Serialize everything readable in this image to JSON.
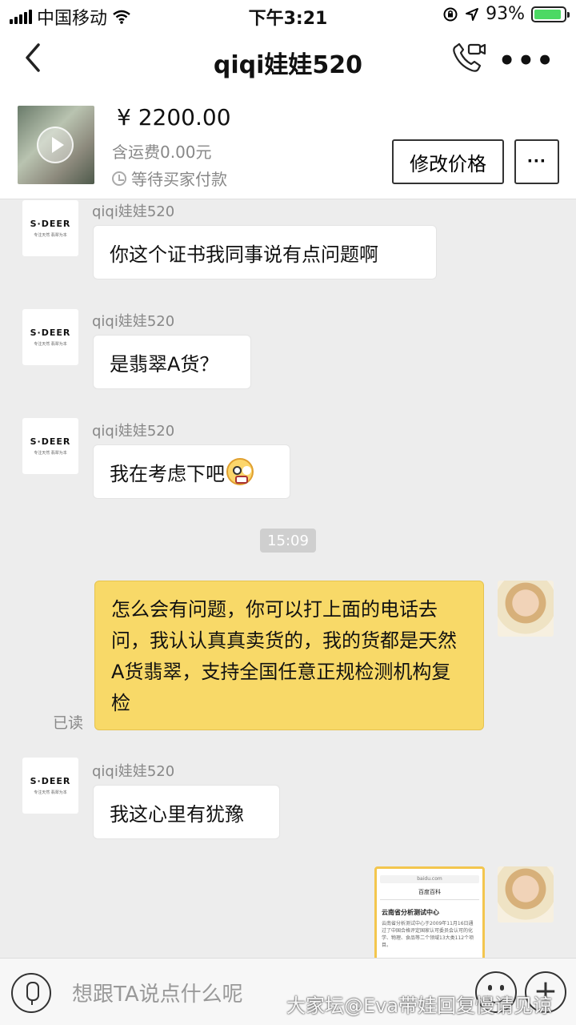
{
  "status_bar": {
    "carrier": "中国移动",
    "time": "下午3:21",
    "battery": "93%",
    "battery_level": 0.93,
    "battery_color": "#4cd964"
  },
  "nav": {
    "title": "qiqi娃娃520",
    "back_icon": "chevron-left-icon",
    "call_icon": "phone-video-icon",
    "more_icon": "more-horizontal-icon"
  },
  "product": {
    "price": "¥ 2200.00",
    "shipping": "含运费0.00元",
    "status": "等待买家付款",
    "edit_price_label": "修改价格",
    "more_label": "···"
  },
  "seller_avatar": {
    "brand": "S·DEER",
    "tagline": "专注天然 翡翠为本"
  },
  "messages": [
    {
      "sender": "qiqi娃娃520",
      "text": "你这个证书我同事说有点问题啊"
    },
    {
      "sender": "qiqi娃娃520",
      "text": "是翡翠A货？"
    },
    {
      "sender": "qiqi娃娃520",
      "text": "我在考虑下吧"
    },
    {
      "time": "15:09"
    },
    {
      "text": "怎么会有问题，你可以打上面的电话去问，我认认真真卖货的，我的货都是天然A货翡翠，支持全国任意正规检测机构复检",
      "read": "已读"
    },
    {
      "sender": "qiqi娃娃520",
      "text": "我这心里有犹豫"
    },
    {
      "image": {
        "url": "baidu.com",
        "site": "百度百科",
        "heading": "云南省分析测试中心",
        "snippet": "云南省分析测试中心于2009年11月16日通过了中国合格评定国家认可委员会认可的化学、物理、食品等二个领域13大类112个项目。"
      }
    }
  ],
  "input": {
    "placeholder": "想跟TA说点什么呢",
    "watermark": "大家坛@Eva带娃回复慢请见谅"
  },
  "colors": {
    "accent_bubble": "#f8d968",
    "background": "#ededed"
  }
}
